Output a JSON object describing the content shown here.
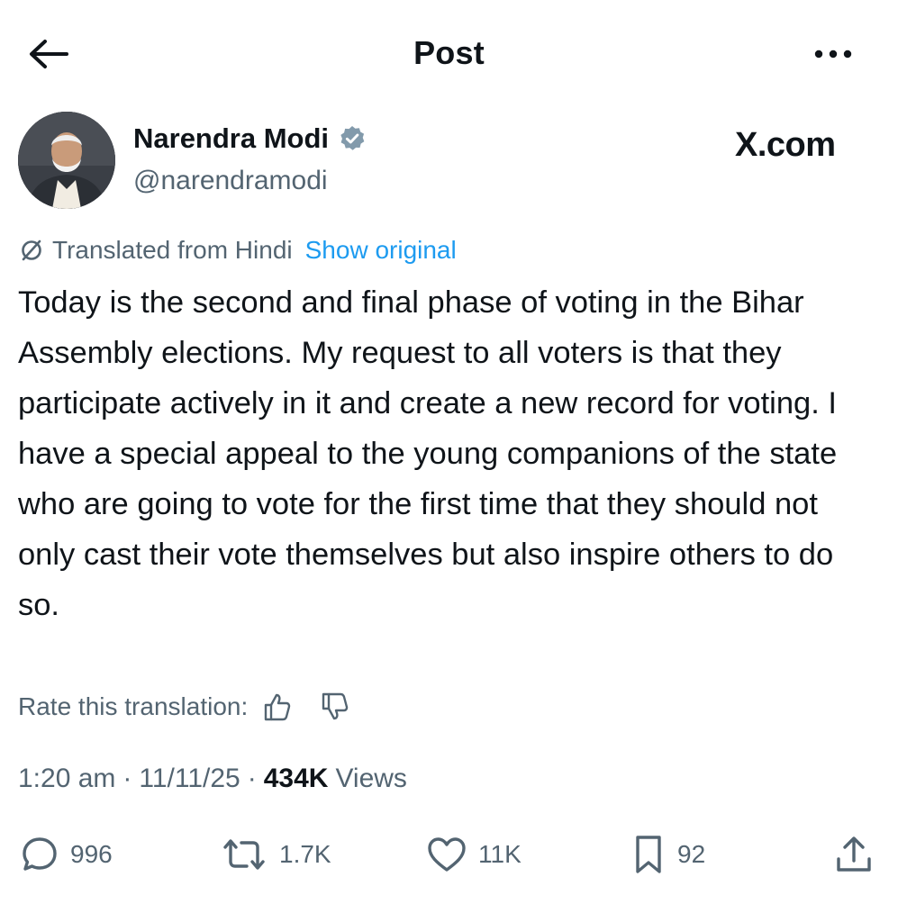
{
  "header": {
    "title": "Post"
  },
  "author": {
    "name": "Narendra Modi",
    "handle": "@narendramodi"
  },
  "watermark": "X.com",
  "translation": {
    "label": "Translated from Hindi",
    "show_original": "Show original"
  },
  "post": {
    "text": "Today is the second and final phase of voting in the Bihar Assembly elections. My request to all voters is that they participate actively in it and create a new record for voting. I have a special appeal to the young companions of the state who are going to vote for the first time that they should not only cast their vote themselves but also inspire others to do so."
  },
  "rate": {
    "label": "Rate this translation:"
  },
  "meta": {
    "time": "1:20 am",
    "date": "11/11/25",
    "views_count": "434K",
    "views_label": "Views",
    "separator": "·"
  },
  "actions": {
    "replies": "996",
    "reposts": "1.7K",
    "likes": "11K",
    "bookmarks": "92"
  },
  "colors": {
    "text_primary": "#0f1419",
    "text_secondary": "#536471",
    "link": "#1d9bf0",
    "verified_badge": "#829aab"
  },
  "icons": [
    "back-arrow-icon",
    "more-options-icon",
    "verified-badge-icon",
    "translate-icon",
    "thumbs-up-icon",
    "thumbs-down-icon",
    "reply-icon",
    "repost-icon",
    "like-icon",
    "bookmark-icon",
    "share-icon"
  ]
}
